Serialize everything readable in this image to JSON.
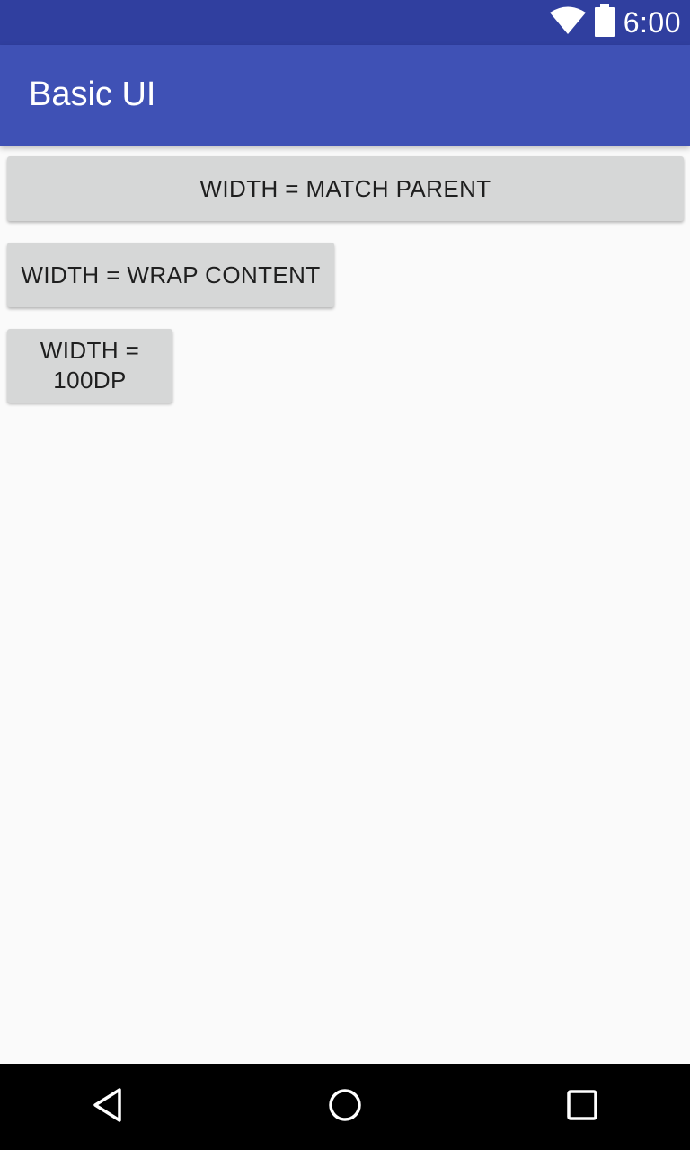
{
  "status_bar": {
    "time": "6:00",
    "icons": [
      "wifi-icon",
      "battery-icon"
    ]
  },
  "app_bar": {
    "title": "Basic UI"
  },
  "buttons": {
    "match_parent": "WIDTH = MATCH PARENT",
    "wrap_content": "WIDTH = WRAP CONTENT",
    "fixed_100dp_line1": "WIDTH =",
    "fixed_100dp_line2": "100DP"
  },
  "nav_bar": {
    "icons": [
      "back-icon",
      "home-icon",
      "recents-icon"
    ]
  },
  "colors": {
    "status_bar": "#303f9f",
    "app_bar": "#3f51b5",
    "background": "#fafafa",
    "button": "#d6d7d7",
    "nav_bar": "#000000"
  }
}
